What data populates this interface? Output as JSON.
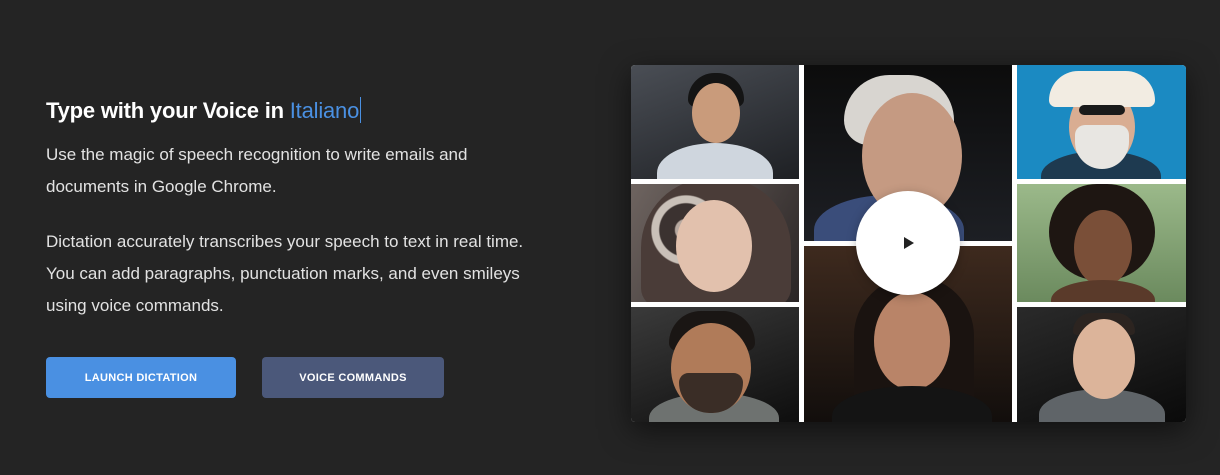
{
  "hero": {
    "title_prefix": "Type with your Voice in ",
    "title_language": "Italiano",
    "paragraph1": "Use the magic of speech recognition to write emails and documents in Google Chrome.",
    "paragraph2": "Dictation accurately transcribes your speech to text in real time. You can add paragraphs, punctuation marks, and even smileys using voice commands."
  },
  "buttons": {
    "launch_label": "LAUNCH DICTATION",
    "commands_label": "VOICE COMMANDS"
  },
  "colors": {
    "accent": "#4a90e2",
    "secondary_button": "#4b587a",
    "background": "#242424"
  },
  "video": {
    "play_icon": "play-icon"
  }
}
